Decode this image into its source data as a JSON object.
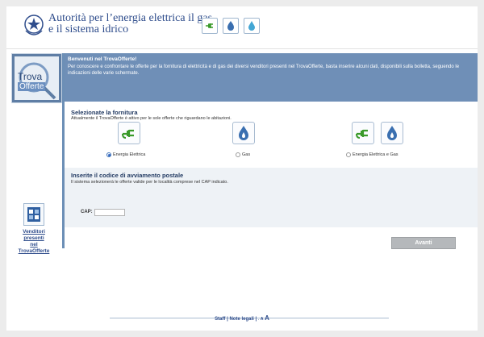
{
  "header": {
    "title_line1": "Autorità per l’energia elettrica il gas",
    "title_line2": "e il sistema idrico",
    "icons": [
      "electric-plug-icon",
      "gas-flame-icon",
      "water-drop-icon"
    ]
  },
  "sidebar": {
    "logo_line1": "Trova",
    "logo_line2": "Offerte",
    "vendors_link_line1": "Venditori presenti",
    "vendors_link_line2": "nel TrovaOfferte"
  },
  "banner": {
    "title": "Benvenuti nel TrovaOfferte!",
    "text": "Per conoscere e confrontare le offerte per la fornitura di elettricità e di gas dei diversi venditori presenti nel TrovaOfferte, basta inserire alcuni dati, disponibili sulla bolletta, seguendo le indicazioni delle varie schermate."
  },
  "fornitura": {
    "title": "Selezionate la fornitura",
    "subtitle": "Attualmente il TrovaOfferte è attivo per le sole offerte che riguardano le abitazioni.",
    "options": [
      {
        "label": "Energia Elettrica",
        "selected": true
      },
      {
        "label": "Gas",
        "selected": false
      },
      {
        "label": "Energia Elettrica e Gas",
        "selected": false
      }
    ]
  },
  "cap": {
    "title": "Inserite il codice di avviamento postale",
    "subtitle": "Il sistema selezionerà le offerte valide per le località comprese nel CAP indicato.",
    "label": "CAP:",
    "value": ""
  },
  "actions": {
    "next_label": "Avanti"
  },
  "footer": {
    "staff": "Staff",
    "sep1": " | ",
    "legal": "Note legali",
    "sep2": " | ",
    "font_small": "-",
    "font_mid": "A",
    "font_large": "A"
  },
  "colors": {
    "brand_blue": "#2f4d8c",
    "banner": "#6f8fb7",
    "electric_green": "#3a9a2a",
    "gas_blue": "#3a6fb0",
    "water_blue": "#43a6d4"
  }
}
